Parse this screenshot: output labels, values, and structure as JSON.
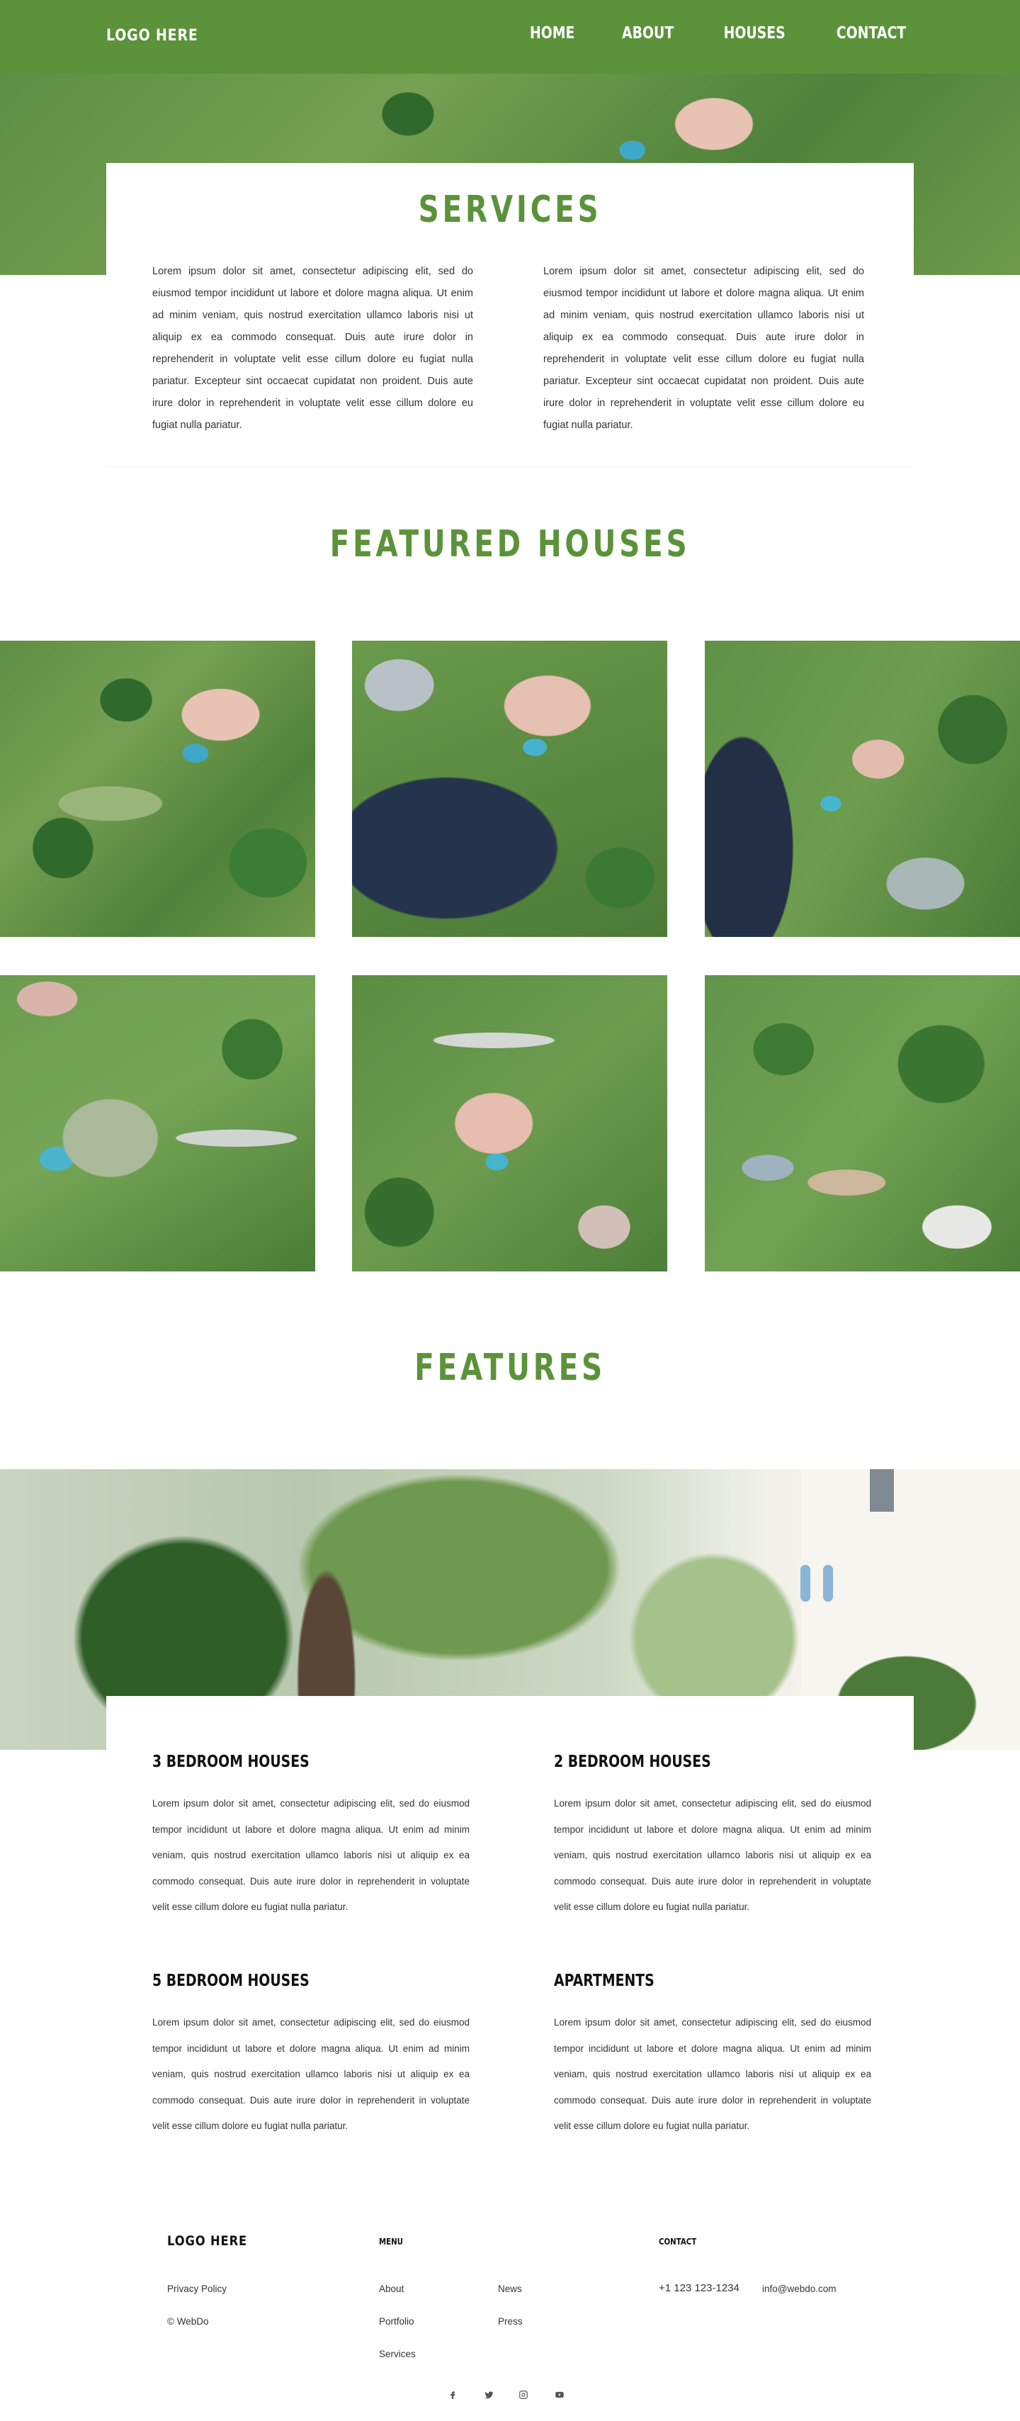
{
  "header": {
    "logo": "LOGO HERE",
    "nav": [
      "HOME",
      "ABOUT",
      "HOUSES",
      "CONTACT"
    ]
  },
  "services": {
    "title": "SERVICES",
    "col_left": "Lorem ipsum dolor sit amet, consectetur adipiscing elit, sed do eiusmod tempor incididunt ut labore et dolore magna aliqua. Ut enim ad minim veniam, quis nostrud exercitation ullamco laboris nisi ut aliquip ex ea commodo consequat. Duis aute irure dolor in reprehenderit in voluptate velit esse cillum dolore eu fugiat nulla pariatur. Excepteur sint occaecat cupidatat non proident. Duis aute irure dolor in reprehenderit in voluptate velit esse cillum dolore eu fugiat nulla pariatur.",
    "col_right": "Lorem ipsum dolor sit amet, consectetur adipiscing elit, sed do eiusmod tempor incididunt ut labore et dolore magna aliqua. Ut enim ad minim veniam, quis nostrud exercitation ullamco laboris nisi ut aliquip ex ea commodo consequat. Duis aute irure dolor in reprehenderit in voluptate velit esse cillum dolore eu fugiat nulla pariatur. Excepteur sint occaecat cupidatat non proident. Duis aute irure dolor in reprehenderit in voluptate velit esse cillum dolore eu fugiat nulla pariatur."
  },
  "featured": {
    "title": "FEATURED HOUSES"
  },
  "features": {
    "title": "FEATURES",
    "items": [
      {
        "heading": "3 BEDROOM HOUSES",
        "text": "Lorem ipsum dolor sit amet, consectetur adipiscing elit, sed do eiusmod tempor incididunt ut labore et dolore magna aliqua. Ut enim ad minim veniam, quis nostrud exercitation ullamco laboris nisi ut aliquip ex ea commodo consequat. Duis aute irure dolor in reprehenderit in voluptate velit esse cillum dolore eu fugiat nulla pariatur."
      },
      {
        "heading": "2 BEDROOM HOUSES",
        "text": "Lorem ipsum dolor sit amet, consectetur adipiscing elit, sed do eiusmod tempor incididunt ut labore et dolore magna aliqua. Ut enim ad minim veniam, quis nostrud exercitation ullamco laboris nisi ut aliquip ex ea commodo consequat. Duis aute irure dolor in reprehenderit in voluptate velit esse cillum dolore eu fugiat nulla pariatur."
      },
      {
        "heading": "5 BEDROOM HOUSES",
        "text": "Lorem ipsum dolor sit amet, consectetur adipiscing elit, sed do eiusmod tempor incididunt ut labore et dolore magna aliqua. Ut enim ad minim veniam, quis nostrud exercitation ullamco laboris nisi ut aliquip ex ea commodo consequat. Duis aute irure dolor in reprehenderit in voluptate velit esse cillum dolore eu fugiat nulla pariatur."
      },
      {
        "heading": "APARTMENTS",
        "text": "Lorem ipsum dolor sit amet, consectetur adipiscing elit, sed do eiusmod tempor incididunt ut labore et dolore magna aliqua. Ut enim ad minim veniam, quis nostrud exercitation ullamco laboris nisi ut aliquip ex ea commodo consequat. Duis aute irure dolor in reprehenderit in voluptate velit esse cillum dolore eu fugiat nulla pariatur."
      }
    ]
  },
  "footer": {
    "logo": "LOGO HERE",
    "privacy": "Privacy Policy",
    "copyright": "© WebDo",
    "menu_heading": "MENU",
    "menu": [
      "About",
      "Portfolio",
      "Services",
      "News",
      "Press"
    ],
    "contact_heading": "CONTACT",
    "phone": "+1 123 123-1234",
    "email": "info@webdo.com",
    "social_icons": [
      "facebook-icon",
      "twitter-icon",
      "instagram-icon",
      "youtube-icon"
    ]
  },
  "colors": {
    "brand_green": "#5b923a",
    "text_dark": "#222222"
  }
}
